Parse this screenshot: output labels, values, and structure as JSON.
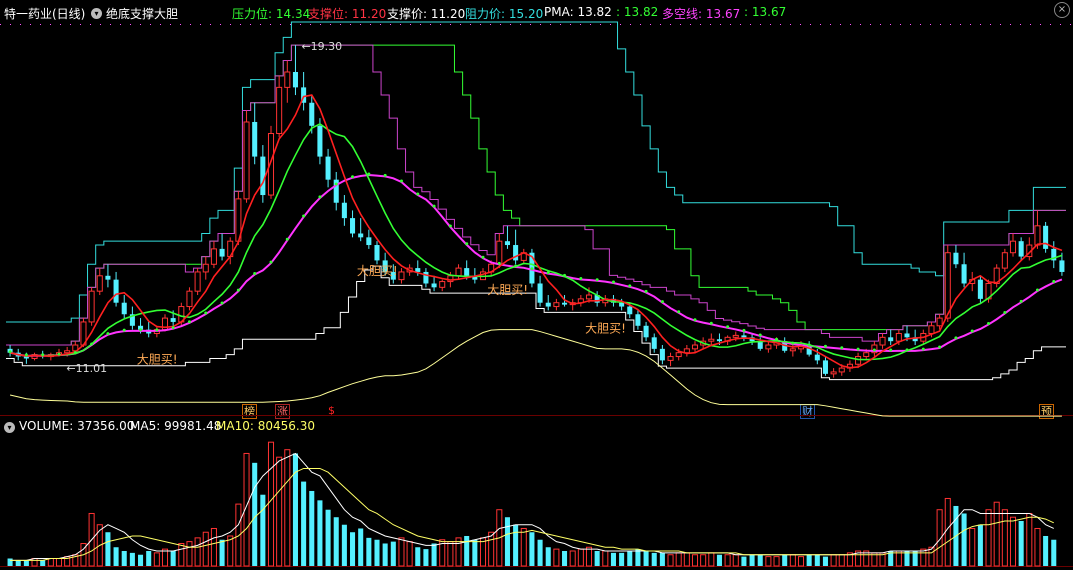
{
  "header": {
    "stock_name": "特一药业(日线)",
    "indicator_name": "绝底支撑大胆",
    "items": [
      {
        "label": "压力位",
        "value": "14.34",
        "color": "#33ff33"
      },
      {
        "label": "支撑位",
        "value": "11.20",
        "color": "#ff3344"
      },
      {
        "label": "支撑价",
        "value": "11.20",
        "color": "#ffffff"
      },
      {
        "label": "阻力价",
        "value": "15.20",
        "color": "#33dddd"
      },
      {
        "label": "PMA",
        "value": "13.82",
        "color": "#ffffff"
      },
      {
        "label": "",
        "value": "13.82",
        "color": "#33ff33"
      },
      {
        "label": "多空线",
        "value": "13.67",
        "color": "#ff44ff"
      },
      {
        "label": "",
        "value": "13.67",
        "color": "#33ff33"
      }
    ]
  },
  "volume_header": {
    "volume_label": "VOLUME:",
    "volume_value": "37356.00",
    "ma5_label": "MA5:",
    "ma5_value": "99981.48",
    "ma10_label": "MA10:",
    "ma10_value": "80456.30"
  },
  "markers": [
    {
      "text": "榜",
      "color": "#ffcc66",
      "border": "#cc6600"
    },
    {
      "text": "涨",
      "color": "#ff6666",
      "border": "#aa2222"
    },
    {
      "text": "$",
      "color": "#ff2222",
      "border": ""
    },
    {
      "text": "财",
      "color": "#66aaff",
      "border": "#2255aa"
    },
    {
      "text": "预",
      "color": "#ffcc66",
      "border": "#cc6600"
    }
  ],
  "chart_data": {
    "type": "candlestick",
    "price_range": [
      10.2,
      19.9
    ],
    "high_label": "19.30",
    "low_label": "11.01",
    "buy_signal_text": "大胆买!",
    "colors": {
      "up": "#ff3333",
      "down": "#54f0ff",
      "ma_fast": "#ff2020",
      "ma_slow": "#ff33ff",
      "ma_mid": "#33ff33",
      "resistance": "#33dddd",
      "pressure": "#33ff33",
      "support": "#ffffff",
      "support_curve": "#ffff99",
      "band": "#cc44cc"
    },
    "candles": [
      [
        11.4,
        11.5,
        11.2,
        11.3
      ],
      [
        11.3,
        11.4,
        11.1,
        11.2
      ],
      [
        11.2,
        11.3,
        11.01,
        11.15
      ],
      [
        11.15,
        11.3,
        11.1,
        11.25
      ],
      [
        11.25,
        11.35,
        11.15,
        11.2
      ],
      [
        11.2,
        11.3,
        11.1,
        11.25
      ],
      [
        11.25,
        11.4,
        11.2,
        11.3
      ],
      [
        11.3,
        11.45,
        11.2,
        11.35
      ],
      [
        11.35,
        11.6,
        11.3,
        11.5
      ],
      [
        11.5,
        12.2,
        11.45,
        12.1
      ],
      [
        12.1,
        13.0,
        12.0,
        12.9
      ],
      [
        12.9,
        13.5,
        12.8,
        13.3
      ],
      [
        13.3,
        13.6,
        13.0,
        13.2
      ],
      [
        13.2,
        13.4,
        12.5,
        12.6
      ],
      [
        12.6,
        12.8,
        12.2,
        12.3
      ],
      [
        12.3,
        12.5,
        11.9,
        12.0
      ],
      [
        12.0,
        12.2,
        11.8,
        11.9
      ],
      [
        11.9,
        12.1,
        11.7,
        11.8
      ],
      [
        11.8,
        12.0,
        11.7,
        11.9
      ],
      [
        11.9,
        12.3,
        11.85,
        12.2
      ],
      [
        12.2,
        12.4,
        12.0,
        12.1
      ],
      [
        12.1,
        12.6,
        12.0,
        12.5
      ],
      [
        12.5,
        13.0,
        12.4,
        12.9
      ],
      [
        12.9,
        13.5,
        12.8,
        13.4
      ],
      [
        13.4,
        13.8,
        13.2,
        13.6
      ],
      [
        13.6,
        14.2,
        13.5,
        14.0
      ],
      [
        14.0,
        14.4,
        13.7,
        13.8
      ],
      [
        13.8,
        14.3,
        13.6,
        14.2
      ],
      [
        14.2,
        15.5,
        14.1,
        15.3
      ],
      [
        15.3,
        17.6,
        15.2,
        17.3
      ],
      [
        17.3,
        17.8,
        16.2,
        16.4
      ],
      [
        16.4,
        16.7,
        15.2,
        15.4
      ],
      [
        15.4,
        17.2,
        15.3,
        17.0
      ],
      [
        17.0,
        18.5,
        16.9,
        18.2
      ],
      [
        18.2,
        18.9,
        17.8,
        18.6
      ],
      [
        18.6,
        19.3,
        18.0,
        18.2
      ],
      [
        18.2,
        18.6,
        17.6,
        17.8
      ],
      [
        17.8,
        18.0,
        17.0,
        17.2
      ],
      [
        17.2,
        17.4,
        16.2,
        16.4
      ],
      [
        16.4,
        16.6,
        15.6,
        15.8
      ],
      [
        15.8,
        16.0,
        15.0,
        15.2
      ],
      [
        15.2,
        15.4,
        14.6,
        14.8
      ],
      [
        14.8,
        15.0,
        14.3,
        14.4
      ],
      [
        14.4,
        14.8,
        14.2,
        14.3
      ],
      [
        14.3,
        14.5,
        14.0,
        14.1
      ],
      [
        14.1,
        14.2,
        13.6,
        13.7
      ],
      [
        13.7,
        13.9,
        13.3,
        13.4
      ],
      [
        13.4,
        13.6,
        13.1,
        13.2
      ],
      [
        13.2,
        13.5,
        13.1,
        13.4
      ],
      [
        13.4,
        13.6,
        13.3,
        13.5
      ],
      [
        13.5,
        13.7,
        13.3,
        13.4
      ],
      [
        13.4,
        13.5,
        13.0,
        13.1
      ],
      [
        13.1,
        13.3,
        12.9,
        13.0
      ],
      [
        13.0,
        13.2,
        12.9,
        13.15
      ],
      [
        13.15,
        13.4,
        13.0,
        13.3
      ],
      [
        13.3,
        13.6,
        13.2,
        13.5
      ],
      [
        13.5,
        13.7,
        13.2,
        13.3
      ],
      [
        13.3,
        13.5,
        13.1,
        13.2
      ],
      [
        13.2,
        13.5,
        13.2,
        13.4
      ],
      [
        13.4,
        13.7,
        13.3,
        13.6
      ],
      [
        13.6,
        14.4,
        13.5,
        14.2
      ],
      [
        14.2,
        14.6,
        14.0,
        14.1
      ],
      [
        14.1,
        14.5,
        13.6,
        13.7
      ],
      [
        13.7,
        14.0,
        13.6,
        13.9
      ],
      [
        13.9,
        14.0,
        13.0,
        13.1
      ],
      [
        13.1,
        13.3,
        12.5,
        12.6
      ],
      [
        12.6,
        12.8,
        12.4,
        12.5
      ],
      [
        12.5,
        12.7,
        12.4,
        12.6
      ],
      [
        12.6,
        12.8,
        12.5,
        12.55
      ],
      [
        12.55,
        12.7,
        12.4,
        12.6
      ],
      [
        12.6,
        12.8,
        12.5,
        12.7
      ],
      [
        12.7,
        13.0,
        12.6,
        12.8
      ],
      [
        12.8,
        12.9,
        12.5,
        12.6
      ],
      [
        12.6,
        12.8,
        12.5,
        12.7
      ],
      [
        12.7,
        12.8,
        12.5,
        12.6
      ],
      [
        12.6,
        12.7,
        12.4,
        12.5
      ],
      [
        12.5,
        12.6,
        12.2,
        12.3
      ],
      [
        12.3,
        12.4,
        11.9,
        12.0
      ],
      [
        12.0,
        12.1,
        11.6,
        11.7
      ],
      [
        11.7,
        11.8,
        11.3,
        11.4
      ],
      [
        11.4,
        11.5,
        11.0,
        11.1
      ],
      [
        11.1,
        11.3,
        10.95,
        11.2
      ],
      [
        11.2,
        11.4,
        11.1,
        11.3
      ],
      [
        11.3,
        11.5,
        11.2,
        11.4
      ],
      [
        11.4,
        11.6,
        11.3,
        11.5
      ],
      [
        11.5,
        11.7,
        11.4,
        11.6
      ],
      [
        11.6,
        11.8,
        11.5,
        11.65
      ],
      [
        11.65,
        11.8,
        11.5,
        11.6
      ],
      [
        11.6,
        11.75,
        11.5,
        11.7
      ],
      [
        11.7,
        11.85,
        11.6,
        11.75
      ],
      [
        11.75,
        11.9,
        11.6,
        11.7
      ],
      [
        11.7,
        11.8,
        11.5,
        11.6
      ],
      [
        11.6,
        11.7,
        11.35,
        11.4
      ],
      [
        11.4,
        11.6,
        11.3,
        11.5
      ],
      [
        11.5,
        11.7,
        11.4,
        11.6
      ],
      [
        11.6,
        11.7,
        11.3,
        11.35
      ],
      [
        11.35,
        11.5,
        11.2,
        11.4
      ],
      [
        11.4,
        11.6,
        11.3,
        11.5
      ],
      [
        11.5,
        11.6,
        11.2,
        11.25
      ],
      [
        11.25,
        11.4,
        11.0,
        11.1
      ],
      [
        11.1,
        11.2,
        10.7,
        10.75
      ],
      [
        10.75,
        10.9,
        10.65,
        10.8
      ],
      [
        10.8,
        11.0,
        10.7,
        10.9
      ],
      [
        10.9,
        11.1,
        10.8,
        11.0
      ],
      [
        11.0,
        11.3,
        10.9,
        11.2
      ],
      [
        11.2,
        11.4,
        11.1,
        11.3
      ],
      [
        11.3,
        11.6,
        11.2,
        11.5
      ],
      [
        11.5,
        11.8,
        11.4,
        11.7
      ],
      [
        11.7,
        11.9,
        11.5,
        11.6
      ],
      [
        11.6,
        11.9,
        11.5,
        11.8
      ],
      [
        11.8,
        12.0,
        11.6,
        11.7
      ],
      [
        11.7,
        11.9,
        11.5,
        11.6
      ],
      [
        11.6,
        11.9,
        11.5,
        11.8
      ],
      [
        11.8,
        12.1,
        11.7,
        12.0
      ],
      [
        12.0,
        12.3,
        11.9,
        12.2
      ],
      [
        12.2,
        14.1,
        12.1,
        13.9
      ],
      [
        13.9,
        14.1,
        13.5,
        13.6
      ],
      [
        13.6,
        13.9,
        13.0,
        13.1
      ],
      [
        13.1,
        13.4,
        12.9,
        13.2
      ],
      [
        13.2,
        13.3,
        12.6,
        12.7
      ],
      [
        12.7,
        13.2,
        12.6,
        13.1
      ],
      [
        13.1,
        13.6,
        13.0,
        13.5
      ],
      [
        13.5,
        14.0,
        13.4,
        13.9
      ],
      [
        13.9,
        14.4,
        13.8,
        14.2
      ],
      [
        14.2,
        14.3,
        13.7,
        13.8
      ],
      [
        13.8,
        14.3,
        13.7,
        14.1
      ],
      [
        14.1,
        15.0,
        14.0,
        14.6
      ],
      [
        14.6,
        14.7,
        13.9,
        14.0
      ],
      [
        14.0,
        14.2,
        13.5,
        13.7
      ],
      [
        13.7,
        13.9,
        13.3,
        13.4
      ]
    ],
    "volume": [
      4,
      3,
      3,
      4,
      3,
      4,
      4,
      5,
      6,
      12,
      28,
      22,
      18,
      10,
      8,
      7,
      6,
      8,
      7,
      9,
      8,
      12,
      13,
      15,
      18,
      20,
      14,
      16,
      33,
      60,
      55,
      38,
      66,
      58,
      62,
      60,
      45,
      40,
      35,
      30,
      26,
      22,
      18,
      20,
      15,
      14,
      12,
      13,
      15,
      13,
      10,
      9,
      12,
      14,
      13,
      15,
      16,
      14,
      15,
      18,
      30,
      26,
      22,
      20,
      18,
      14,
      10,
      9,
      8,
      8,
      9,
      10,
      8,
      8,
      7,
      7,
      8,
      9,
      8,
      7,
      7,
      6,
      7,
      7,
      6,
      6,
      7,
      6,
      6,
      6,
      5,
      6,
      6,
      5,
      5,
      6,
      6,
      5,
      6,
      6,
      5,
      6,
      6,
      7,
      8,
      8,
      7,
      7,
      8,
      8,
      8,
      8,
      9,
      10,
      30,
      36,
      32,
      28,
      20,
      22,
      30,
      34,
      30,
      26,
      24,
      28,
      20,
      16,
      14
    ],
    "vol_ma5": [
      3,
      3,
      3,
      4,
      4,
      4,
      4,
      5,
      6,
      9,
      14,
      19,
      22,
      20,
      18,
      14,
      11,
      9,
      8,
      8,
      8,
      9,
      10,
      11,
      13,
      15,
      16,
      18,
      22,
      32,
      42,
      48,
      52,
      56,
      58,
      60,
      55,
      50,
      48,
      42,
      36,
      30,
      26,
      24,
      20,
      18,
      16,
      15,
      14,
      13,
      12,
      11,
      11,
      12,
      12,
      12,
      13,
      14,
      15,
      16,
      20,
      21,
      22,
      22,
      22,
      20,
      16,
      13,
      12,
      10,
      9,
      9,
      9,
      8,
      8,
      8,
      8,
      8,
      8,
      8,
      7,
      7,
      7,
      7,
      7,
      7,
      7,
      7,
      7,
      6,
      6,
      6,
      6,
      6,
      6,
      6,
      6,
      6,
      6,
      6,
      6,
      6,
      6,
      6,
      7,
      7,
      7,
      7,
      8,
      8,
      8,
      8,
      8,
      9,
      14,
      20,
      25,
      30,
      30,
      28,
      28,
      28,
      28,
      28,
      28,
      28,
      26,
      22,
      20
    ],
    "vol_ma10": [
      3,
      3,
      3,
      3,
      3,
      4,
      4,
      4,
      5,
      6,
      8,
      11,
      13,
      14,
      15,
      16,
      16,
      15,
      14,
      13,
      12,
      11,
      10,
      10,
      11,
      12,
      13,
      14,
      16,
      20,
      26,
      30,
      35,
      40,
      45,
      50,
      52,
      52,
      52,
      50,
      46,
      42,
      38,
      34,
      30,
      28,
      25,
      22,
      20,
      18,
      16,
      15,
      14,
      13,
      13,
      13,
      13,
      13,
      13,
      14,
      15,
      17,
      18,
      18,
      19,
      18,
      17,
      16,
      15,
      14,
      13,
      12,
      11,
      10,
      10,
      9,
      9,
      9,
      8,
      8,
      8,
      8,
      8,
      7,
      7,
      7,
      7,
      7,
      7,
      7,
      6,
      6,
      6,
      6,
      6,
      6,
      6,
      6,
      6,
      6,
      6,
      6,
      6,
      6,
      6,
      6,
      6,
      6,
      7,
      7,
      7,
      7,
      7,
      7,
      10,
      13,
      16,
      19,
      21,
      22,
      22,
      23,
      24,
      24,
      25,
      26,
      26,
      25,
      23
    ]
  }
}
